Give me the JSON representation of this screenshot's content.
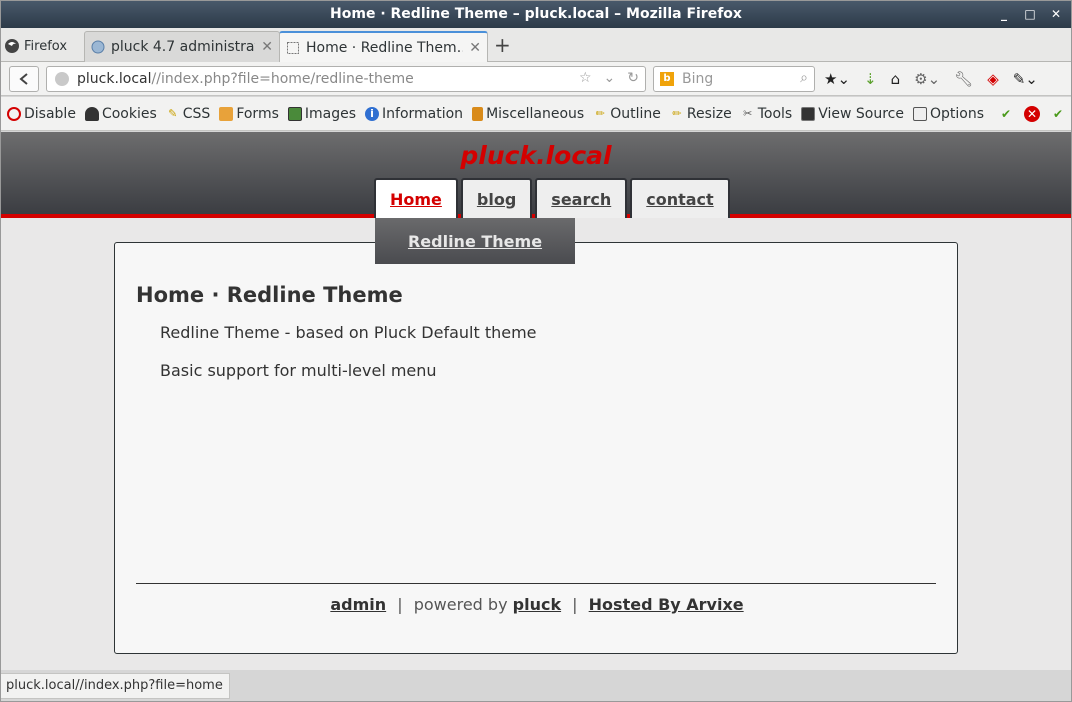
{
  "window": {
    "title": "Home · Redline Theme – pluck.local – Mozilla Firefox",
    "controls": [
      "_",
      "□",
      "✕"
    ]
  },
  "tabs": {
    "firefox_label": "Firefox",
    "items": [
      {
        "label": "pluck 4.7 administrat…",
        "close": "✕"
      },
      {
        "label": "Home · Redline Them…",
        "close": "✕"
      }
    ],
    "new_tab": "+"
  },
  "navbar": {
    "url_host": "pluck.local",
    "url_path": "//index.php?file=home/redline-theme",
    "search_placeholder": "Bing",
    "bing_glyph": "b"
  },
  "devtoolbar": {
    "items": [
      {
        "label": "Disable",
        "icon": "disable-icon",
        "color": "#d40000"
      },
      {
        "label": "Cookies",
        "icon": "cookies-icon",
        "color": "#333333"
      },
      {
        "label": "CSS",
        "icon": "css-icon",
        "color": "#c9a000"
      },
      {
        "label": "Forms",
        "icon": "forms-icon",
        "color": "#c57b00"
      },
      {
        "label": "Images",
        "icon": "images-icon",
        "color": "#4a8a3a"
      },
      {
        "label": "Information",
        "icon": "information-icon",
        "color": "#2f6fd1"
      },
      {
        "label": "Miscellaneous",
        "icon": "miscellaneous-icon",
        "color": "#c57b00"
      },
      {
        "label": "Outline",
        "icon": "outline-icon",
        "color": "#c9a000"
      },
      {
        "label": "Resize",
        "icon": "resize-icon",
        "color": "#c9a000"
      },
      {
        "label": "Tools",
        "icon": "tools-icon",
        "color": "#555555"
      },
      {
        "label": "View Source",
        "icon": "view-source-icon",
        "color": "#333333"
      },
      {
        "label": "Options",
        "icon": "options-icon",
        "color": "#555555"
      }
    ]
  },
  "site": {
    "title": "pluck.local",
    "nav": [
      "Home",
      "blog",
      "search",
      "contact"
    ],
    "submenu": "Redline Theme",
    "page_title": "Home · Redline Theme",
    "paragraphs": [
      "Redline Theme - based on Pluck Default theme",
      "Basic support for multi-level menu"
    ],
    "footer": {
      "admin": "admin",
      "sep1": "|",
      "powered_by": "powered by",
      "pluck": "pluck",
      "sep2": "|",
      "hosted": "Hosted By Arvixe"
    },
    "colors": {
      "accent": "#d40000",
      "header_dark": "#3b3d42"
    }
  },
  "statusbar": {
    "text": "pluck.local//index.php?file=home"
  }
}
